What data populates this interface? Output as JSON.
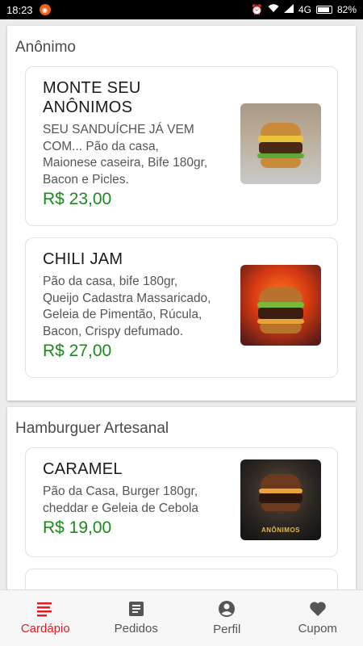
{
  "status_bar": {
    "time": "18:23",
    "network": "4G",
    "battery": "82%"
  },
  "sections": [
    {
      "title": "Anônimo",
      "items": [
        {
          "name": "MONTE SEU ANÔNIMOS",
          "description": "SEU SANDUÍCHE JÁ VEM COM... Pão da casa, Maionese caseira, Bife 180gr, Bacon e Picles.",
          "price": "R$ 23,00"
        },
        {
          "name": "CHILI JAM",
          "description": "Pão da casa, bife 180gr, Queijo Cadastra Massaricado, Geleia de Pimentão, Rúcula, Bacon, Crispy defumado.",
          "price": "R$ 27,00"
        }
      ]
    },
    {
      "title": "Hamburguer Artesanal",
      "items": [
        {
          "name": "CARAMEL",
          "description": "Pão da Casa, Burger 180gr, cheddar e Geleia de Cebola",
          "price": "R$ 19,00",
          "image_logo": "ANÔNIMOS"
        }
      ]
    }
  ],
  "bottom_nav": [
    {
      "label": "Cardápio",
      "icon": "menu-list-icon",
      "active": true
    },
    {
      "label": "Pedidos",
      "icon": "receipt-icon",
      "active": false
    },
    {
      "label": "Perfil",
      "icon": "user-icon",
      "active": false
    },
    {
      "label": "Cupom",
      "icon": "heart-icon",
      "active": false
    }
  ],
  "colors": {
    "accent": "#e01b22",
    "price": "#1a8a1a"
  }
}
